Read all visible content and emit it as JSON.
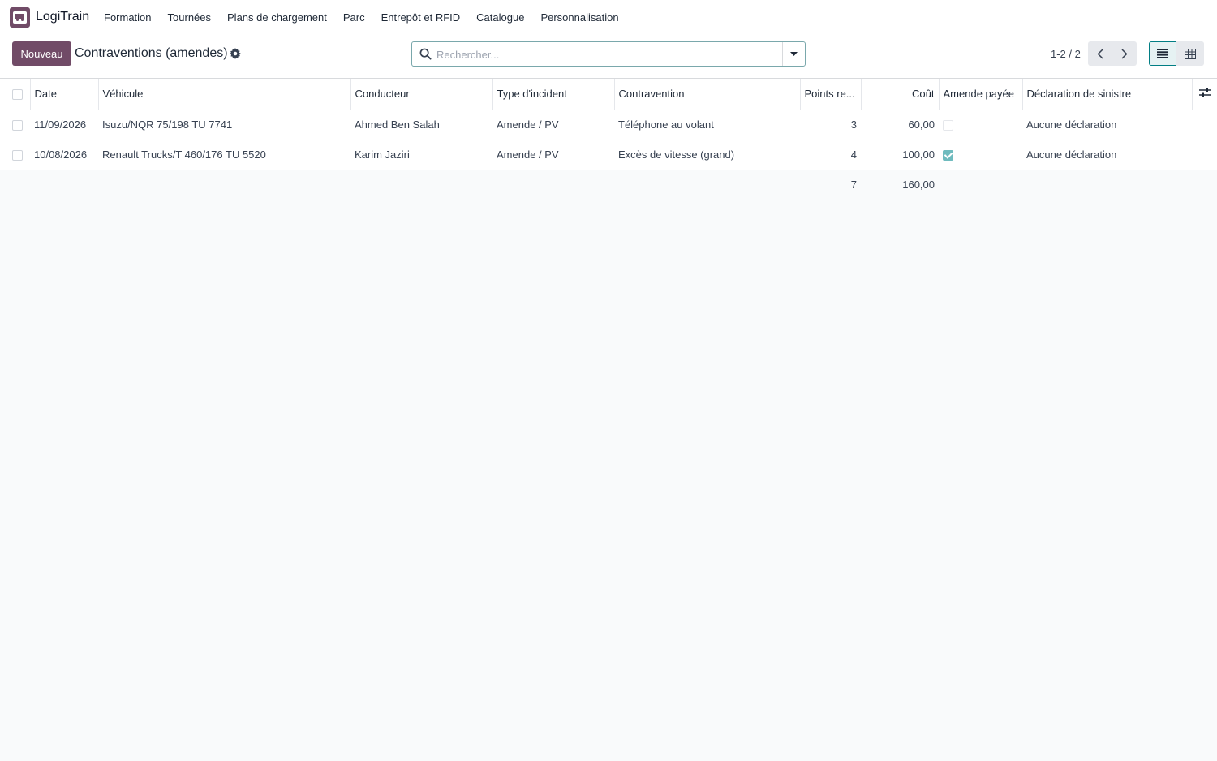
{
  "app": {
    "name": "LogiTrain"
  },
  "menu": [
    "Formation",
    "Tournées",
    "Plans de chargement",
    "Parc",
    "Entrepôt et RFID",
    "Catalogue",
    "Personnalisation"
  ],
  "toolbar": {
    "new_label": "Nouveau",
    "title": "Contraventions (amendes)"
  },
  "search": {
    "placeholder": "Rechercher..."
  },
  "pager": {
    "value": "1-2 / 2"
  },
  "table": {
    "columns": [
      "Date",
      "Véhicule",
      "Conducteur",
      "Type d'incident",
      "Contravention",
      "Points re...",
      "Coût",
      "Amende payée",
      "Déclaration de sinistre"
    ],
    "rows": [
      {
        "date": "11/09/2026",
        "vehicle": "Isuzu/NQR 75/198 TU 7741",
        "driver": "Ahmed Ben Salah",
        "type": "Amende / PV",
        "offense": "Téléphone au volant",
        "points": "3",
        "cost": "60,00",
        "paid": false,
        "claim": "Aucune déclaration"
      },
      {
        "date": "10/08/2026",
        "vehicle": "Renault Trucks/T 460/176 TU 5520",
        "driver": "Karim Jaziri",
        "type": "Amende / PV",
        "offense": "Excès de vitesse (grand)",
        "points": "4",
        "cost": "100,00",
        "paid": true,
        "claim": "Aucune déclaration"
      }
    ],
    "totals": {
      "points": "7",
      "cost": "160,00"
    }
  },
  "colors": {
    "brand": "#714b67",
    "accent": "#017e84",
    "check": "#6fbbbe"
  }
}
